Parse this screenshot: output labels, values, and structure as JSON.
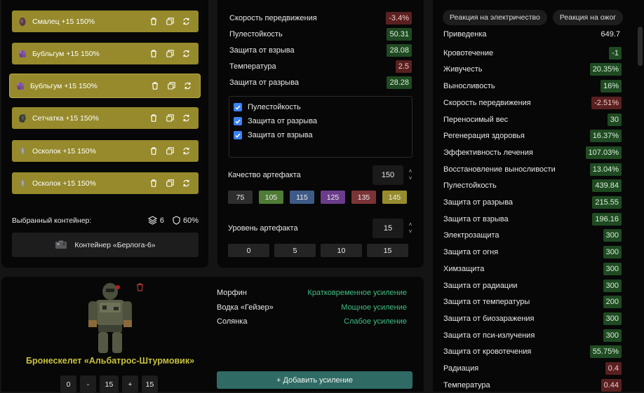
{
  "artifacts": [
    {
      "name": "Смалец",
      "bonus": "+15",
      "quality": "150%",
      "icon": "meat-artifact-icon",
      "selected": false
    },
    {
      "name": "Бубльгум",
      "bonus": "+15",
      "quality": "150%",
      "icon": "purple-blob-artifact-icon",
      "selected": false
    },
    {
      "name": "Бубльгум",
      "bonus": "+15",
      "quality": "150%",
      "icon": "purple-blob-artifact-icon",
      "selected": true
    },
    {
      "name": "Сетчатка",
      "bonus": "+15",
      "quality": "150%",
      "icon": "dark-stone-artifact-icon",
      "selected": false
    },
    {
      "name": "Осколок",
      "bonus": "+15",
      "quality": "150%",
      "icon": "shard-artifact-icon",
      "selected": false
    },
    {
      "name": "Осколок",
      "bonus": "+15",
      "quality": "150%",
      "icon": "shard-artifact-icon",
      "selected": false
    }
  ],
  "container": {
    "label": "Выбранный контейнер:",
    "slots": "6",
    "protection": "60%",
    "button_label": "Контейнер «Берлога-6»"
  },
  "artifact_stats": [
    {
      "name": "Скорость передвижения",
      "value": "-3.4%",
      "tone": "red"
    },
    {
      "name": "Пулестойкость",
      "value": "50.31",
      "tone": "green"
    },
    {
      "name": "Защита от взрыва",
      "value": "28.08",
      "tone": "green"
    },
    {
      "name": "Температура",
      "value": "2.5",
      "tone": "red"
    },
    {
      "name": "Защита от разрыва",
      "value": "28.28",
      "tone": "green"
    }
  ],
  "checkboxes": [
    {
      "label": "Пулестойкость",
      "checked": true
    },
    {
      "label": "Защита от разрыва",
      "checked": true
    },
    {
      "label": "Защита от взрыва",
      "checked": true
    }
  ],
  "quality": {
    "label": "Качество артефакта",
    "value": "150",
    "presets": [
      {
        "label": "75",
        "color": "#2e2e2e"
      },
      {
        "label": "105",
        "color": "#4f7b36"
      },
      {
        "label": "115",
        "color": "#3e5a86"
      },
      {
        "label": "125",
        "color": "#6b3c8a"
      },
      {
        "label": "135",
        "color": "#7b3436"
      },
      {
        "label": "145",
        "color": "#978c2d"
      }
    ]
  },
  "level": {
    "label": "Уровень артефакта",
    "value": "15",
    "presets": [
      "0",
      "5",
      "10",
      "15"
    ]
  },
  "right": {
    "tabs": [
      "Реакция на электричество",
      "Реакция на ожог"
    ],
    "stats": [
      {
        "name": "Приведенка",
        "value": "649.7",
        "tone": "plain"
      },
      {
        "name": "Кровотечение",
        "value": "-1",
        "tone": "green"
      },
      {
        "name": "Живучесть",
        "value": "20.35%",
        "tone": "green"
      },
      {
        "name": "Выносливость",
        "value": "16%",
        "tone": "green"
      },
      {
        "name": "Скорость передвижения",
        "value": "-2.51%",
        "tone": "red"
      },
      {
        "name": "Переносимый вес",
        "value": "30",
        "tone": "green"
      },
      {
        "name": "Регенерация здоровья",
        "value": "16.37%",
        "tone": "green"
      },
      {
        "name": "Эффективность лечения",
        "value": "107.03%",
        "tone": "green"
      },
      {
        "name": "Восстановление выносливости",
        "value": "13.04%",
        "tone": "green"
      },
      {
        "name": "Пулестойкость",
        "value": "439.84",
        "tone": "green"
      },
      {
        "name": "Защита от разрыва",
        "value": "215.55",
        "tone": "green"
      },
      {
        "name": "Защита от взрыва",
        "value": "196.16",
        "tone": "green"
      },
      {
        "name": "Электрозащита",
        "value": "300",
        "tone": "green"
      },
      {
        "name": "Защита от огня",
        "value": "300",
        "tone": "green"
      },
      {
        "name": "Химзащита",
        "value": "300",
        "tone": "green"
      },
      {
        "name": "Защита от радиации",
        "value": "300",
        "tone": "green"
      },
      {
        "name": "Защита от температуры",
        "value": "200",
        "tone": "green"
      },
      {
        "name": "Защита от биозаражения",
        "value": "300",
        "tone": "green"
      },
      {
        "name": "Защита от пси-излучения",
        "value": "300",
        "tone": "green"
      },
      {
        "name": "Защита от кровотечения",
        "value": "55.75%",
        "tone": "green"
      },
      {
        "name": "Радиация",
        "value": "0.4",
        "tone": "red"
      },
      {
        "name": "Температура",
        "value": "0.44",
        "tone": "red"
      }
    ]
  },
  "suit": {
    "name": "Бронескелет «Альбатрос-Штурмовик»",
    "icon": "armor-suit-image",
    "level_controls": {
      "min": "0",
      "minus": "-",
      "value": "15",
      "plus": "+",
      "max": "15"
    }
  },
  "boosts": [
    {
      "name": "Морфин",
      "effect": "Кратковременное усиление"
    },
    {
      "name": "Водка «Гейзер»",
      "effect": "Мощное усиление"
    },
    {
      "name": "Солянка",
      "effect": "Слабое усиление"
    }
  ],
  "add_boost_label": "+ Добавить усиление"
}
